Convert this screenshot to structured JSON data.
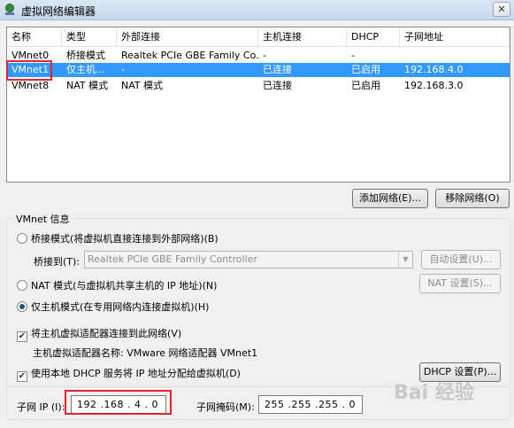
{
  "window": {
    "title": "虚拟网络编辑器",
    "close_glyph": "✕"
  },
  "table": {
    "headers": [
      "名称",
      "类型",
      "外部连接",
      "主机连接",
      "DHCP",
      "子网地址"
    ],
    "rows": [
      {
        "name": "VMnet0",
        "type": "桥接模式",
        "external": "Realtek PCIe GBE Family Co...",
        "host": "-",
        "dhcp": "-",
        "subnet": ""
      },
      {
        "name": "VMnet1",
        "type": "仅主机...",
        "external": "-",
        "host": "已连接",
        "dhcp": "已启用",
        "subnet": "192.168.4.0"
      },
      {
        "name": "VMnet8",
        "type": "NAT 模式",
        "external": "NAT 模式",
        "host": "已连接",
        "dhcp": "已启用",
        "subnet": "192.168.3.0"
      }
    ],
    "selected_row": 1
  },
  "buttons": {
    "add_network": "添加网络(E)...",
    "remove_network": "移除网络(O)"
  },
  "vmnet_info": {
    "legend": "VMnet 信息",
    "bridge_mode": "桥接模式(将虚拟机直接连接到外部网络)(B)",
    "bridge_to_label": "桥接到(T):",
    "bridge_to_value": "Realtek PCIe GBE Family Controller",
    "auto_settings": "自动设置(U)...",
    "nat_mode": "NAT 模式(与虚拟机共享主机的 IP 地址)(N)",
    "nat_settings": "NAT 设置(S)...",
    "host_only_mode": "仅主机模式(在专用网络内连接虚拟机)(H)",
    "selected_mode": "host-only",
    "connect_adapter": "将主机虚拟适配器连接到此网络(V)",
    "connect_adapter_checked": true,
    "adapter_name": "主机虚拟适配器名称: VMware 网络适配器 VMnet1",
    "use_dhcp": "使用本地 DHCP 服务将 IP 地址分配给虚拟机(D)",
    "use_dhcp_checked": true,
    "dhcp_settings": "DHCP 设置(P)...",
    "subnet_ip_label": "子网 IP (I):",
    "subnet_ip": "192 .168 .  4  .  0",
    "subnet_mask_label": "子网掩码(M):",
    "subnet_mask": "255 .255 .255 .  0"
  },
  "watermark": "Bai 经验",
  "colors": {
    "selection": "#3399ff",
    "annotation_red": "#e0262e"
  }
}
